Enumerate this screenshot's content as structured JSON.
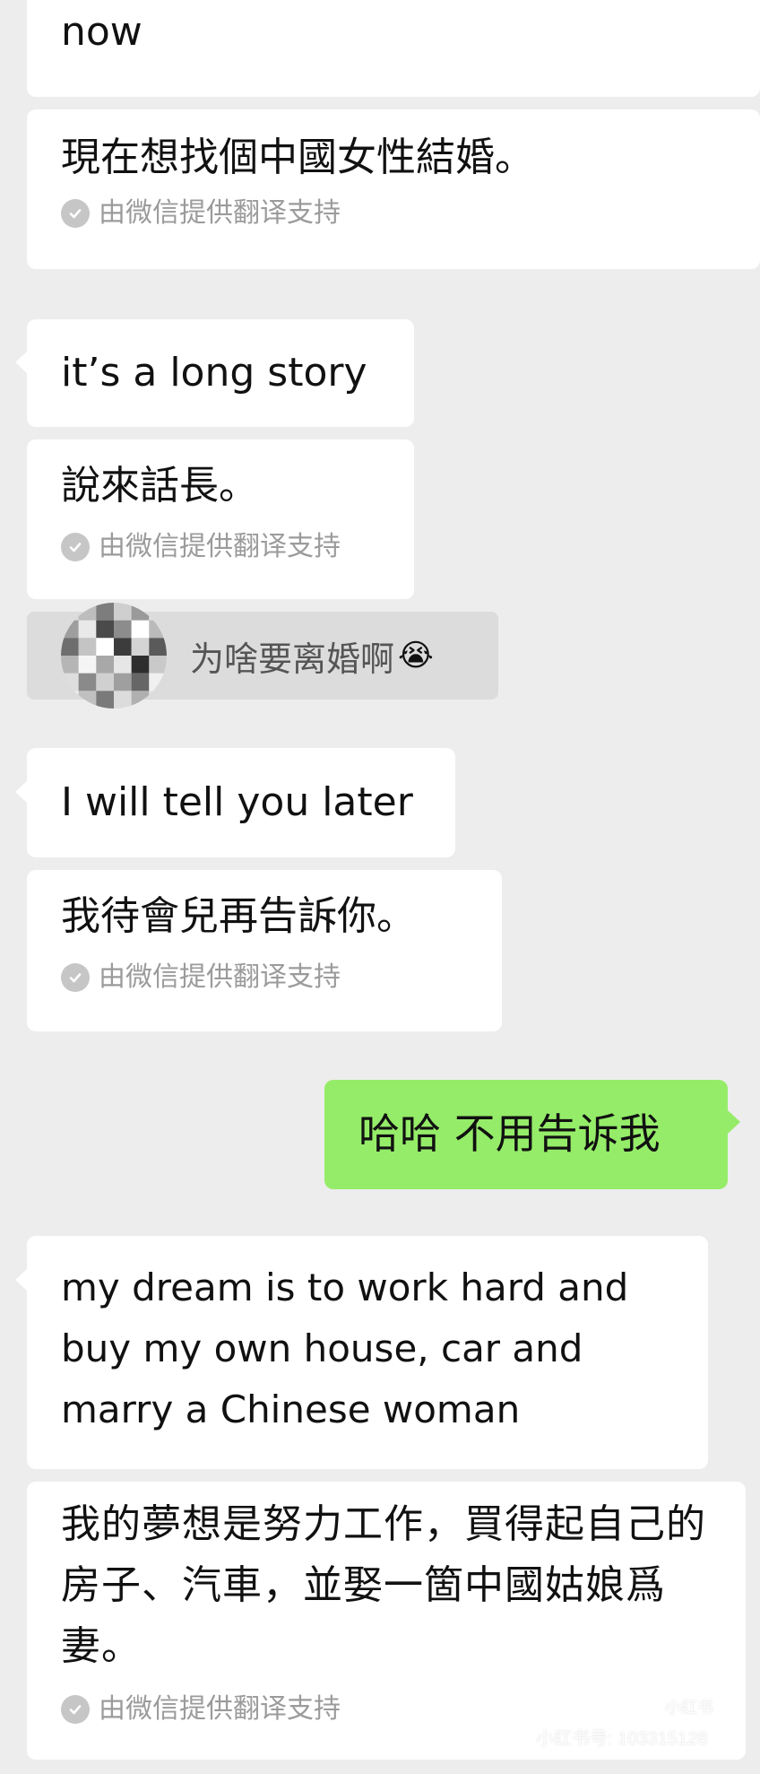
{
  "messages": {
    "m1_original": "now",
    "m1_translation": "現在想找個中國女性結婚。",
    "m2_original": "it’s a long story",
    "m2_translation": "說來話長。",
    "quote_text": "为啥要离婚啊",
    "quote_emoji": "😭",
    "m3_original": "I will tell you later",
    "m3_translation": "我待會兒再告訴你。",
    "me_reply": "哈哈 不用告诉我",
    "m4_original": "my dream is to work hard and buy my own house, car and marry a Chinese woman",
    "m4_translation": "我的夢想是努力工作，買得起自己的房子、汽車，並娶一箇中國姑娘爲妻。"
  },
  "translation_note": "由微信提供翻译支持",
  "watermark": {
    "logo": "小红书",
    "id": "小红书号: 103315128"
  },
  "colors": {
    "background": "#ededed",
    "incoming_bubble": "#ffffff",
    "outgoing_bubble": "#95ec69",
    "note_text": "#9b9b9b"
  }
}
